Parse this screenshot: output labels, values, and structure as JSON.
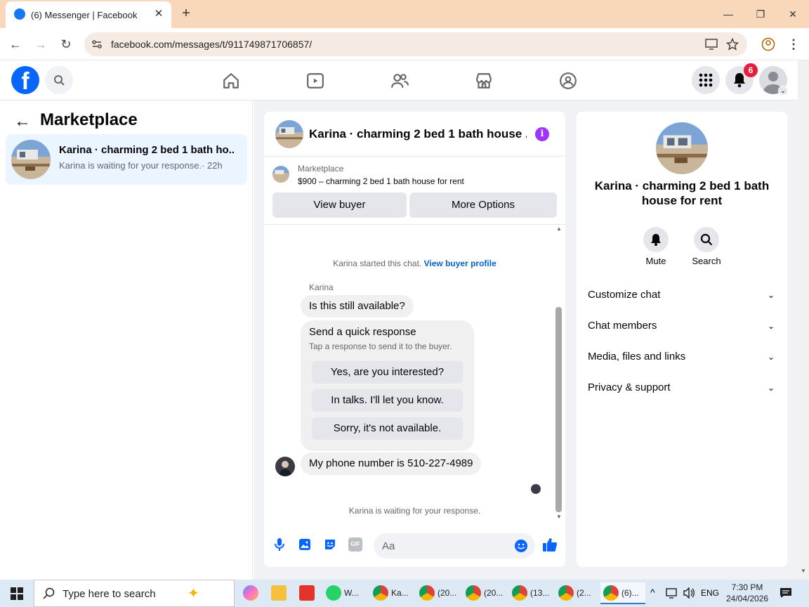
{
  "browser": {
    "tab_title": "(6) Messenger | Facebook",
    "url": "facebook.com/messages/t/911749871706857/"
  },
  "fb": {
    "notification_count": "6",
    "brand_color": "#1877f2"
  },
  "left": {
    "title": "Marketplace",
    "conversation": {
      "name": "Karina · charming 2 bed 1 bath ho...",
      "preview": "Karina is waiting for your response.",
      "time": "· 22h"
    }
  },
  "chat": {
    "title": "Karina · charming 2 bed 1 bath house ...",
    "listing_source": "Marketplace",
    "listing_desc": "$900 – charming 2 bed 1 bath house for rent",
    "view_buyer": "View buyer",
    "more_options": "More Options",
    "started_text": "Karina started this chat.",
    "view_buyer_profile": "View buyer profile",
    "sender_name": "Karina",
    "msg1": "Is this still available?",
    "quick_title": "Send a quick response",
    "quick_sub": "Tap a response to send it to the buyer.",
    "quick_replies": [
      "Yes, are you interested?",
      "In talks. I'll let you know.",
      "Sorry, it's not available."
    ],
    "msg2": "My phone number is 510-227-4989",
    "waiting": "Karina is waiting for your response.",
    "input_placeholder": "Aa"
  },
  "details": {
    "title": "Karina · charming 2 bed 1 bath house for rent",
    "mute": "Mute",
    "search": "Search",
    "rows": [
      "Customize chat",
      "Chat members",
      "Media, files and links",
      "Privacy & support"
    ]
  },
  "taskbar": {
    "search_placeholder": "Type here to search",
    "apps": [
      "W...",
      "Ka...",
      "(20...",
      "(20...",
      "(13...",
      "(2...",
      "(6)..."
    ],
    "time": "7:30 PM",
    "date": "24/04/2026",
    "lang": "ENG"
  }
}
